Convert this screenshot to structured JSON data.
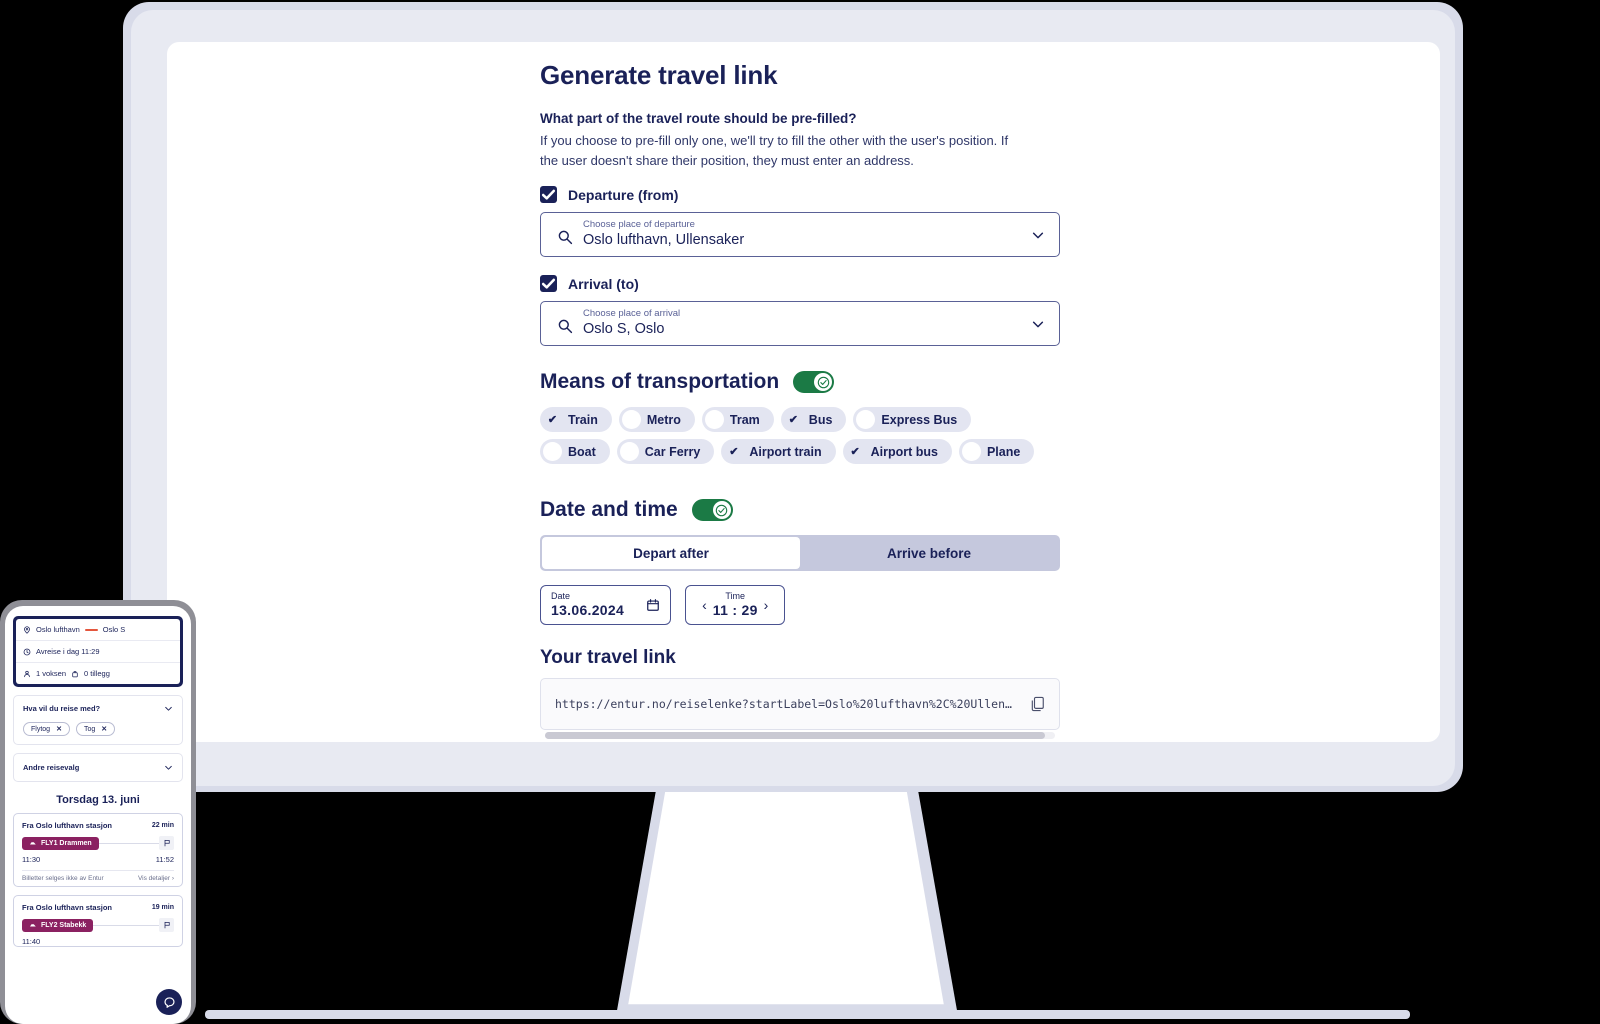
{
  "page": {
    "title": "Generate travel link",
    "question_heading": "What part of the travel route should be pre-filled?",
    "question_subtext": "If you choose to pre-fill only one, we'll try to fill the other with the user's position. If the user doesn't share their position, they must enter an address."
  },
  "departure": {
    "checkbox_label": "Departure (from)",
    "checked": true,
    "field_label": "Choose place of departure",
    "field_value": "Oslo lufthavn, Ullensaker"
  },
  "arrival": {
    "checkbox_label": "Arrival (to)",
    "checked": true,
    "field_label": "Choose place of arrival",
    "field_value": "Oslo S, Oslo"
  },
  "transport": {
    "heading": "Means of transportation",
    "toggle_on": true,
    "options": [
      {
        "label": "Train",
        "selected": true
      },
      {
        "label": "Metro",
        "selected": false
      },
      {
        "label": "Tram",
        "selected": false
      },
      {
        "label": "Bus",
        "selected": true
      },
      {
        "label": "Express Bus",
        "selected": false
      },
      {
        "label": "Boat",
        "selected": false
      },
      {
        "label": "Car Ferry",
        "selected": false
      },
      {
        "label": "Airport train",
        "selected": true
      },
      {
        "label": "Airport bus",
        "selected": true
      },
      {
        "label": "Plane",
        "selected": false
      }
    ]
  },
  "datetime": {
    "heading": "Date and time",
    "toggle_on": true,
    "tabs": [
      {
        "label": "Depart after",
        "active": true
      },
      {
        "label": "Arrive before",
        "active": false
      }
    ],
    "date_label": "Date",
    "date_value": "13.06.2024",
    "time_label": "Time",
    "time_value": "11 : 29"
  },
  "travel_link": {
    "heading": "Your travel link",
    "url": "https://entur.no/reiselenke?startLabel=Oslo%20lufthavn%2C%20Ullen…"
  },
  "phone": {
    "summary": {
      "from": "Oslo lufthavn",
      "to": "Oslo S",
      "departure": "Avreise i dag 11:29",
      "passengers": "1 voksen",
      "extras": "0 tillegg"
    },
    "filter_card": {
      "title": "Hva vil du reise med?",
      "chips": [
        "Flytog",
        "Tog"
      ],
      "chip_remove": "✕"
    },
    "other_options": "Andre reisevalg",
    "day_heading": "Torsdag 13. juni",
    "trips": [
      {
        "from": "Fra Oslo lufthavn stasjon",
        "duration": "22 min",
        "line": "FLY1 Drammen",
        "depart_time": "11:30",
        "arrive_time": "11:52",
        "note": "Billetter selges ikke av Entur",
        "details": "Vis detaljer"
      },
      {
        "from": "Fra Oslo lufthavn stasjon",
        "duration": "19 min",
        "line": "FLY2 Stabekk",
        "depart_time": "11:40",
        "arrive_time": "",
        "note": "",
        "details": ""
      }
    ]
  },
  "colors": {
    "navy": "#1a2158",
    "green_toggle": "#1b7a45",
    "chip_bg": "#e3e5f1",
    "badge_purple": "#8b2161",
    "accent_orange": "#e4563d",
    "monitor_frame": "#e8eaf2"
  }
}
